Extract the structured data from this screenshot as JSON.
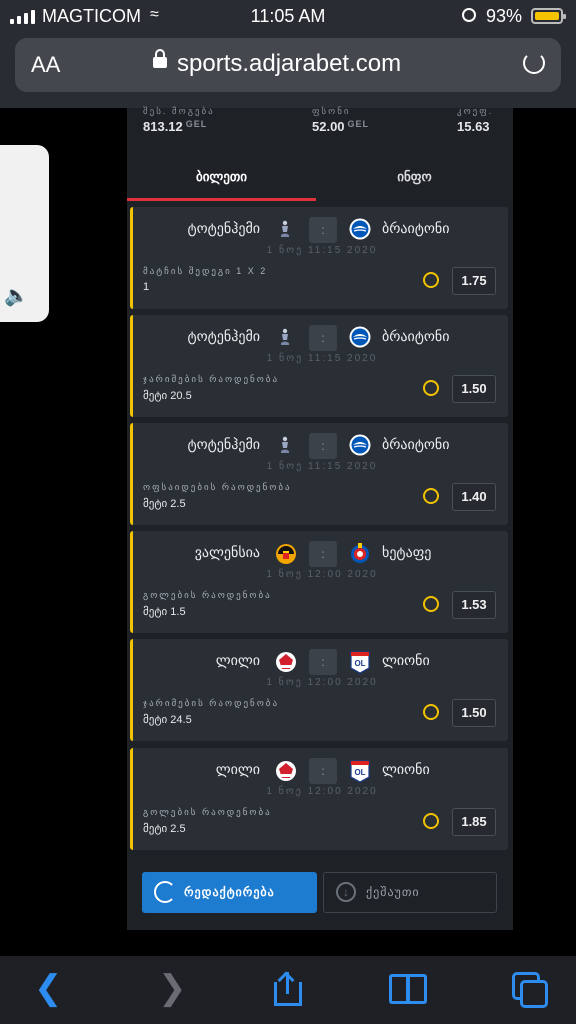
{
  "status_bar": {
    "carrier": "MAGTICOM",
    "time": "11:05 AM",
    "battery": "93%"
  },
  "browser": {
    "aa_label": "AA",
    "url": "sports.adjarabet.com"
  },
  "summary": {
    "win_label": "შეს. მოგება",
    "win_value": "813.12",
    "win_currency": "GEL",
    "stake_label": "ფსონი",
    "stake_value": "52.00",
    "stake_currency": "GEL",
    "coef_label": "კოეფ.",
    "coef_value": "15.63"
  },
  "tabs": {
    "ticket": "ბილეთი",
    "info": "ინფო"
  },
  "bets": [
    {
      "home": "ტოტენჰემი",
      "away": "ბრაიტონი",
      "score": ":",
      "date": "1 ნოე 11:15 2020",
      "market": "მატჩის შედეგი 1 X 2",
      "selection": "1",
      "odd": "1.75",
      "home_logo": "tottenham",
      "away_logo": "brighton"
    },
    {
      "home": "ტოტენჰემი",
      "away": "ბრაიტონი",
      "score": ":",
      "date": "1 ნოე 11:15 2020",
      "market": "ჯარიმების რაოდენობა",
      "selection": "მეტი 20.5",
      "odd": "1.50",
      "home_logo": "tottenham",
      "away_logo": "brighton"
    },
    {
      "home": "ტოტენჰემი",
      "away": "ბრაიტონი",
      "score": ":",
      "date": "1 ნოე 11:15 2020",
      "market": "ოფსაიდების რაოდენობა",
      "selection": "მეტი 2.5",
      "odd": "1.40",
      "home_logo": "tottenham",
      "away_logo": "brighton"
    },
    {
      "home": "ვალენსია",
      "away": "ხეტაფე",
      "score": ":",
      "date": "1 ნოე 12:00 2020",
      "market": "გოლების რაოდენობა",
      "selection": "მეტი 1.5",
      "odd": "1.53",
      "home_logo": "valencia",
      "away_logo": "getafe"
    },
    {
      "home": "ლილი",
      "away": "ლიონი",
      "score": ":",
      "date": "1 ნოე 12:00 2020",
      "market": "ჯარიმების რაოდენობა",
      "selection": "მეტი 24.5",
      "odd": "1.50",
      "home_logo": "lille",
      "away_logo": "lyon"
    },
    {
      "home": "ლილი",
      "away": "ლიონი",
      "score": ":",
      "date": "1 ნოე 12:00 2020",
      "market": "გოლების რაოდენობა",
      "selection": "მეტი 2.5",
      "odd": "1.85",
      "home_logo": "lille",
      "away_logo": "lyon"
    }
  ],
  "actions": {
    "edit": "რედაქტირება",
    "delete": "ქეშაუთი"
  },
  "icons": {
    "back": "chevron-left-icon",
    "forward": "chevron-right-icon",
    "share": "share-icon",
    "bookmarks": "book-icon",
    "tabs": "tabs-icon"
  },
  "colors": {
    "accent": "#f2c200",
    "tab_underline": "#e0323a",
    "primary_button": "#1d7bd0"
  }
}
